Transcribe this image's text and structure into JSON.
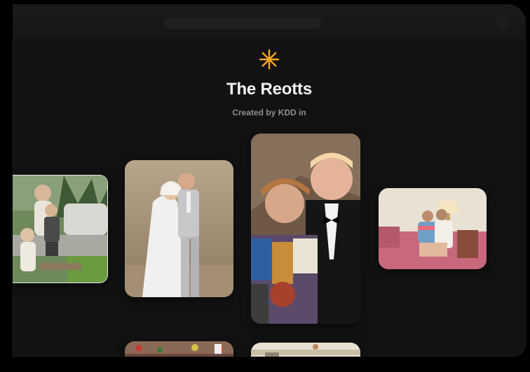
{
  "album": {
    "title": "The Reotts",
    "subtitle": "Created by KDD in"
  },
  "icons": {
    "header_icon": "asterisk-icon",
    "accent_color": "#f5a623"
  },
  "photos": [
    {
      "id": "family-yard-photo"
    },
    {
      "id": "wedding-couple-photo"
    },
    {
      "id": "mother-son-tuxedo-photo"
    },
    {
      "id": "couch-portrait-photo"
    },
    {
      "id": "christmas-room-photo"
    },
    {
      "id": "living-room-photo"
    }
  ]
}
